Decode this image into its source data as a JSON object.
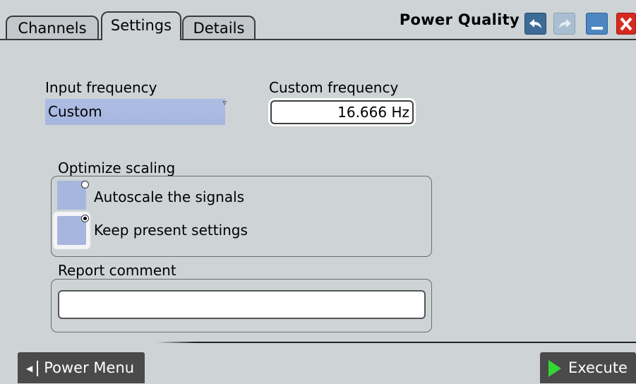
{
  "tabs": [
    {
      "label": "Channels",
      "active": false
    },
    {
      "label": "Settings",
      "active": true
    },
    {
      "label": "Details",
      "active": false
    }
  ],
  "title": "Power Quality",
  "toolbar": {
    "undo_icon": "undo-arrow-icon",
    "redo_icon": "redo-arrow-icon",
    "minimize_icon": "minimize-icon",
    "close_icon": "close-x-icon"
  },
  "input_frequency": {
    "label": "Input frequency",
    "value": "Custom"
  },
  "custom_frequency": {
    "label": "Custom frequency",
    "value": "16.666 Hz"
  },
  "optimize_scaling": {
    "label": "Optimize scaling",
    "options": [
      {
        "label": "Autoscale the signals",
        "selected": false
      },
      {
        "label": "Keep present settings",
        "selected": true
      }
    ]
  },
  "report_comment": {
    "label": "Report comment",
    "value": ""
  },
  "footer": {
    "power_menu": "Power Menu",
    "execute": "Execute"
  },
  "colors": {
    "background": "#ced3d6",
    "selector": "#a7b6de",
    "close": "#d8291f",
    "play": "#33d633"
  }
}
